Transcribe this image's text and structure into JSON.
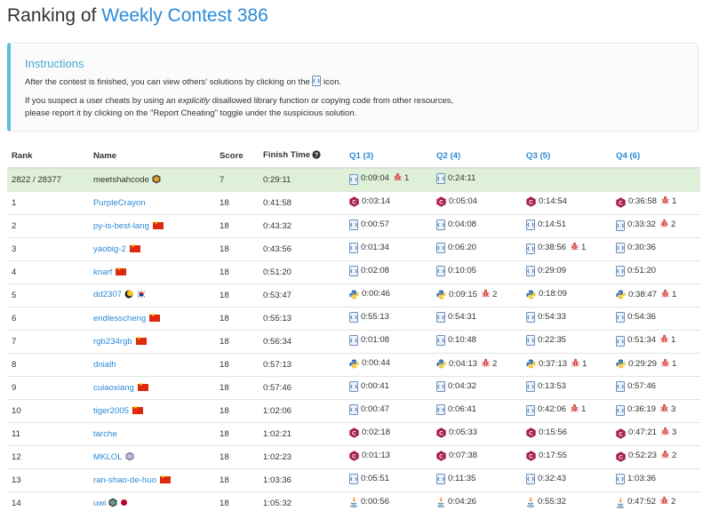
{
  "page": {
    "title_prefix": "Ranking of",
    "contest_name": "Weekly Contest 386"
  },
  "instructions": {
    "heading": "Instructions",
    "line1_before": "After the contest is finished, you can view others' solutions by clicking on the",
    "line1_after": "icon.",
    "line2_before": "If you suspect a user cheats by using an",
    "line2_em": "explicitly",
    "line2_after": "disallowed library function or copying code from other resources,",
    "line3": "please report it by clicking on the \"Report Cheating\" toggle under the suspicious solution."
  },
  "table": {
    "headers": {
      "rank": "Rank",
      "name": "Name",
      "score": "Score",
      "finish": "Finish Time",
      "q1": "Q1 (3)",
      "q2": "Q2 (4)",
      "q3": "Q3 (5)",
      "q4": "Q4 (6)"
    },
    "rows": [
      {
        "rank": "2822 / 28377",
        "name": "meetshahcode",
        "score": "7",
        "finish": "0:29:11",
        "q1": "0:09:04",
        "q2": "0:24:11",
        "q3": "",
        "q4": "",
        "q1_bug": "1",
        "q2_bug": "",
        "q3_bug": "",
        "q4_bug": ""
      },
      {
        "rank": "1",
        "name": "PurpleCrayon",
        "score": "18",
        "finish": "0:41:58",
        "q1": "0:03:14",
        "q2": "0:05:04",
        "q3": "0:14:54",
        "q4": "0:36:58",
        "q1_bug": "",
        "q2_bug": "",
        "q3_bug": "",
        "q4_bug": "1"
      },
      {
        "rank": "2",
        "name": "py-is-best-lang",
        "score": "18",
        "finish": "0:43:32",
        "q1": "0:00:57",
        "q2": "0:04:08",
        "q3": "0:14:51",
        "q4": "0:33:32",
        "q1_bug": "",
        "q2_bug": "",
        "q3_bug": "",
        "q4_bug": "2"
      },
      {
        "rank": "3",
        "name": "yaobig-2",
        "score": "18",
        "finish": "0:43:56",
        "q1": "0:01:34",
        "q2": "0:06:20",
        "q3": "0:38:56",
        "q4": "0:30:36",
        "q1_bug": "",
        "q2_bug": "",
        "q3_bug": "1",
        "q4_bug": ""
      },
      {
        "rank": "4",
        "name": "knarf",
        "score": "18",
        "finish": "0:51:20",
        "q1": "0:02:08",
        "q2": "0:10:05",
        "q3": "0:29:09",
        "q4": "0:51:20",
        "q1_bug": "",
        "q2_bug": "",
        "q3_bug": "",
        "q4_bug": ""
      },
      {
        "rank": "5",
        "name": "dd2307",
        "score": "18",
        "finish": "0:53:47",
        "q1": "0:00:46",
        "q2": "0:09:15",
        "q3": "0:18:09",
        "q4": "0:38:47",
        "q1_bug": "",
        "q2_bug": "2",
        "q3_bug": "",
        "q4_bug": "1"
      },
      {
        "rank": "6",
        "name": "endlesscheng",
        "score": "18",
        "finish": "0:55:13",
        "q1": "0:55:13",
        "q2": "0:54:31",
        "q3": "0:54:33",
        "q4": "0:54:36",
        "q1_bug": "",
        "q2_bug": "",
        "q3_bug": "",
        "q4_bug": ""
      },
      {
        "rank": "7",
        "name": "rgb234rgb",
        "score": "18",
        "finish": "0:56:34",
        "q1": "0:01:08",
        "q2": "0:10:48",
        "q3": "0:22:35",
        "q4": "0:51:34",
        "q1_bug": "",
        "q2_bug": "",
        "q3_bug": "",
        "q4_bug": "1"
      },
      {
        "rank": "8",
        "name": "dnialh",
        "score": "18",
        "finish": "0:57:13",
        "q1": "0:00:44",
        "q2": "0:04:13",
        "q3": "0:37:13",
        "q4": "0:29:29",
        "q1_bug": "",
        "q2_bug": "2",
        "q3_bug": "1",
        "q4_bug": "1"
      },
      {
        "rank": "9",
        "name": "cuiaoxiang",
        "score": "18",
        "finish": "0:57:46",
        "q1": "0:00:41",
        "q2": "0:04:32",
        "q3": "0:13:53",
        "q4": "0:57:46",
        "q1_bug": "",
        "q2_bug": "",
        "q3_bug": "",
        "q4_bug": ""
      },
      {
        "rank": "10",
        "name": "tiger2005",
        "score": "18",
        "finish": "1:02:06",
        "q1": "0:00:47",
        "q2": "0:06:41",
        "q3": "0:42:06",
        "q4": "0:36:19",
        "q1_bug": "",
        "q2_bug": "",
        "q3_bug": "1",
        "q4_bug": "3"
      },
      {
        "rank": "11",
        "name": "tarche",
        "score": "18",
        "finish": "1:02:21",
        "q1": "0:02:18",
        "q2": "0:05:33",
        "q3": "0:15:56",
        "q4": "0:47:21",
        "q1_bug": "",
        "q2_bug": "",
        "q3_bug": "",
        "q4_bug": "3"
      },
      {
        "rank": "12",
        "name": "MKLOL",
        "score": "18",
        "finish": "1:02:23",
        "q1": "0:01:13",
        "q2": "0:07:38",
        "q3": "0:17:55",
        "q4": "0:52:23",
        "q1_bug": "",
        "q2_bug": "",
        "q3_bug": "",
        "q4_bug": "2"
      },
      {
        "rank": "13",
        "name": "ran-shao-de-huo",
        "score": "18",
        "finish": "1:03:36",
        "q1": "0:05:51",
        "q2": "0:11:35",
        "q3": "0:32:43",
        "q4": "1:03:36",
        "q1_bug": "",
        "q2_bug": "",
        "q3_bug": "",
        "q4_bug": ""
      },
      {
        "rank": "14",
        "name": "uwi",
        "score": "18",
        "finish": "1:05:32",
        "q1": "0:00:56",
        "q2": "0:04:26",
        "q3": "0:55:32",
        "q4": "0:47:52",
        "q1_bug": "",
        "q2_bug": "",
        "q3_bug": "",
        "q4_bug": "2"
      }
    ]
  },
  "icons": {
    "file": "file-code-icon",
    "cpp": "cpp-logo-icon",
    "python": "python-logo-icon",
    "java": "java-logo-icon",
    "bug": "bug-icon",
    "help": "question-circle-icon",
    "badge": "user-badge-icon"
  },
  "colors": {
    "link": "#2b8ad8",
    "highlight_row": "#dff0d8",
    "instructions_border": "#5bc0de",
    "bug": "#d9534f",
    "cpp": "#a8204a",
    "flag_cn": "#de2910"
  }
}
